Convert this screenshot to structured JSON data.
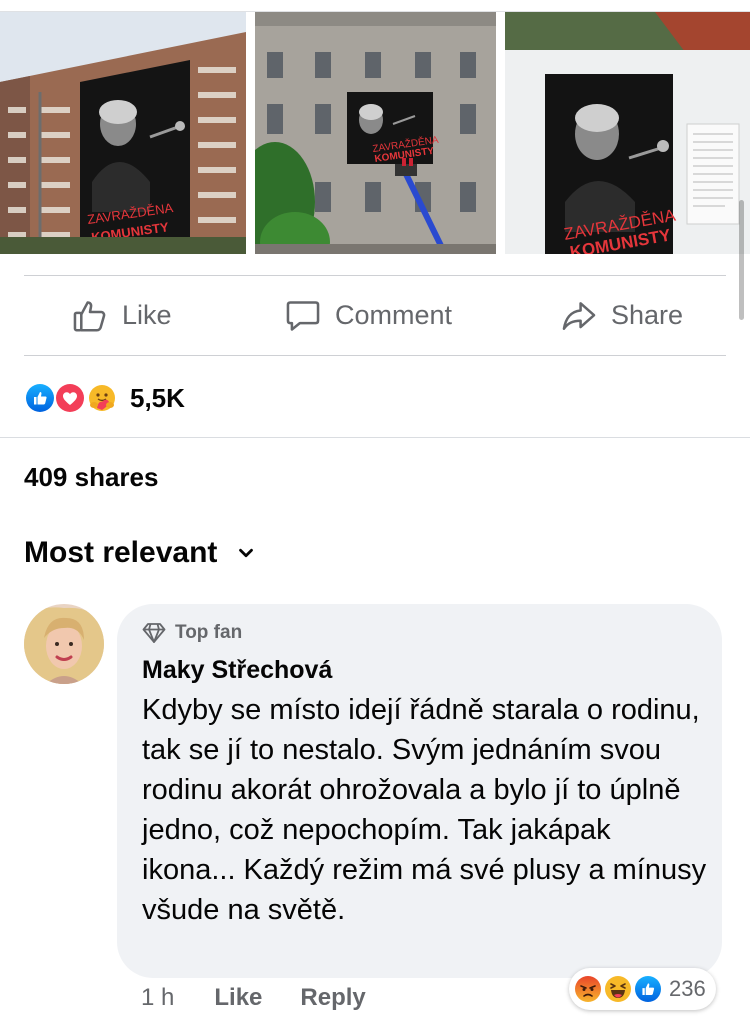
{
  "post": {
    "photos": [
      {
        "name": "photo-1",
        "poster_text_line1": "ZAVRAŽDĚNA",
        "poster_text_line2": "KOMUNISTY"
      },
      {
        "name": "photo-2",
        "poster_text_line1": "ZAVRAŽDĚNA",
        "poster_text_line2": "KOMUNISTY"
      },
      {
        "name": "photo-3",
        "poster_text_line1": "ZAVRAŽDĚNA",
        "poster_text_line2": "KOMUNISTY"
      }
    ],
    "actions": {
      "like": {
        "label": "Like",
        "icon": "thumbs-up-icon"
      },
      "comment": {
        "label": "Comment",
        "icon": "comment-bubble-icon"
      },
      "share": {
        "label": "Share",
        "icon": "share-arrow-icon"
      }
    },
    "reactions": {
      "icons": [
        "like-reaction-icon",
        "love-reaction-icon",
        "care-reaction-icon"
      ],
      "count": "5,5K"
    },
    "shares": "409 shares"
  },
  "comments_section": {
    "sort_label": "Most relevant",
    "sort_icon": "chevron-down-icon",
    "comment": {
      "badge": "Top fan",
      "badge_icon": "diamond-icon",
      "author": "Maky Střechová",
      "text": "Kdyby se místo idejí řádně starala o rodinu, tak se jí to nestalo. Svým jednáním svou rodinu akorát ohrožovala a bylo jí to úplně jedno, což nepochopím. Tak jakápak ikona... Každý režim má své plusy a mínusy všude na světě.",
      "time": "1 h",
      "like_label": "Like",
      "reply_label": "Reply",
      "reaction_icons": [
        "angry-reaction-icon",
        "haha-reaction-icon",
        "like-reaction-icon"
      ],
      "reaction_count": "236"
    }
  },
  "colors": {
    "facebook_blue": "#1877f2",
    "love_red": "#f33e58",
    "care_yellow": "#f7b928",
    "secondary_text": "#65676b",
    "bubble_bg": "#f0f2f5"
  }
}
